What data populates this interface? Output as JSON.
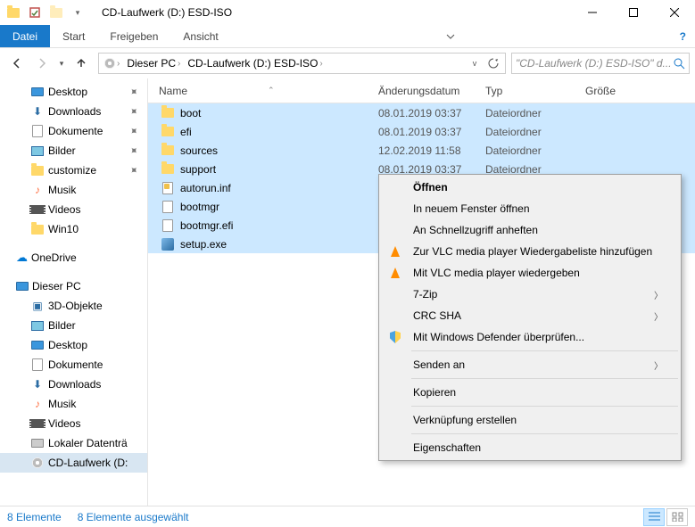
{
  "window": {
    "title": "CD-Laufwerk (D:) ESD-ISO"
  },
  "ribbon": {
    "file": "Datei",
    "tabs": [
      "Start",
      "Freigeben",
      "Ansicht"
    ]
  },
  "breadcrumb": {
    "items": [
      "Dieser PC",
      "CD-Laufwerk (D:) ESD-ISO"
    ]
  },
  "search": {
    "placeholder": "\"CD-Laufwerk (D:) ESD-ISO\" d..."
  },
  "nav": {
    "quick": [
      {
        "label": "Desktop",
        "icon": "desktop",
        "pinned": true
      },
      {
        "label": "Downloads",
        "icon": "downloads",
        "pinned": true
      },
      {
        "label": "Dokumente",
        "icon": "docs",
        "pinned": true
      },
      {
        "label": "Bilder",
        "icon": "pics",
        "pinned": true
      },
      {
        "label": "customize",
        "icon": "folder",
        "pinned": true
      },
      {
        "label": "Musik",
        "icon": "music",
        "pinned": false
      },
      {
        "label": "Videos",
        "icon": "video",
        "pinned": false
      },
      {
        "label": "Win10",
        "icon": "folder",
        "pinned": false
      }
    ],
    "onedrive": "OneDrive",
    "thispc": "Dieser PC",
    "pc_children": [
      "3D-Objekte",
      "Bilder",
      "Desktop",
      "Dokumente",
      "Downloads",
      "Musik",
      "Videos",
      "Lokaler Datenträ",
      "CD-Laufwerk (D:"
    ]
  },
  "columns": {
    "name": "Name",
    "mod": "Änderungsdatum",
    "type": "Typ",
    "size": "Größe"
  },
  "files": [
    {
      "name": "boot",
      "mod": "08.01.2019 03:37",
      "type": "Dateiordner",
      "icon": "folder"
    },
    {
      "name": "efi",
      "mod": "08.01.2019 03:37",
      "type": "Dateiordner",
      "icon": "folder"
    },
    {
      "name": "sources",
      "mod": "12.02.2019 11:58",
      "type": "Dateiordner",
      "icon": "folder"
    },
    {
      "name": "support",
      "mod": "08.01.2019 03:37",
      "type": "Dateiordner",
      "icon": "folder"
    },
    {
      "name": "autorun.inf",
      "mod": "",
      "type": "",
      "icon": "inf"
    },
    {
      "name": "bootmgr",
      "mod": "",
      "type": "",
      "icon": "file"
    },
    {
      "name": "bootmgr.efi",
      "mod": "",
      "type": "",
      "icon": "file"
    },
    {
      "name": "setup.exe",
      "mod": "",
      "type": "",
      "icon": "exe"
    }
  ],
  "context_menu": [
    {
      "label": "Öffnen",
      "bold": true
    },
    {
      "label": "In neuem Fenster öffnen"
    },
    {
      "label": "An Schnellzugriff anheften"
    },
    {
      "label": "Zur VLC media player Wiedergabeliste hinzufügen",
      "icon": "vlc"
    },
    {
      "label": "Mit VLC media player wiedergeben",
      "icon": "vlc"
    },
    {
      "label": "7-Zip",
      "submenu": true
    },
    {
      "label": "CRC SHA",
      "submenu": true
    },
    {
      "label": "Mit Windows Defender überprüfen...",
      "icon": "shield"
    },
    {
      "sep": true
    },
    {
      "label": "Senden an",
      "submenu": true
    },
    {
      "sep": true
    },
    {
      "label": "Kopieren"
    },
    {
      "sep": true
    },
    {
      "label": "Verknüpfung erstellen"
    },
    {
      "sep": true
    },
    {
      "label": "Eigenschaften"
    }
  ],
  "status": {
    "count": "8 Elemente",
    "selected": "8 Elemente ausgewählt"
  }
}
